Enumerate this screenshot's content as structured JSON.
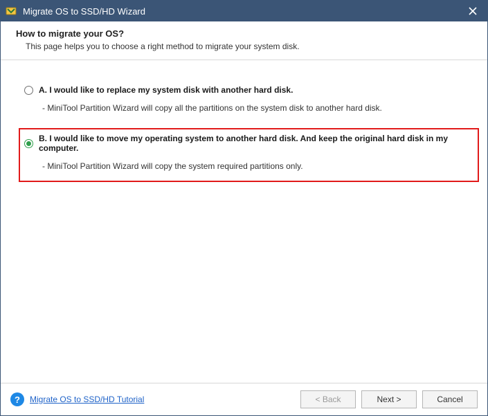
{
  "titlebar": {
    "title": "Migrate OS to SSD/HD Wizard"
  },
  "header": {
    "heading": "How to migrate your OS?",
    "subheading": "This page helps you to choose a right method to migrate your system disk."
  },
  "options": {
    "a": {
      "label": "A. I would like to replace my system disk with another hard disk.",
      "desc": "- MiniTool Partition Wizard will copy all the partitions on the system disk to another hard disk."
    },
    "b": {
      "label": "B. I would like to move my operating system to another hard disk. And keep the original hard disk in my computer.",
      "desc": "- MiniTool Partition Wizard will copy the system required partitions only."
    }
  },
  "footer": {
    "tutorial": "Migrate OS to SSD/HD Tutorial",
    "back": "< Back",
    "next": "Next >",
    "cancel": "Cancel"
  }
}
